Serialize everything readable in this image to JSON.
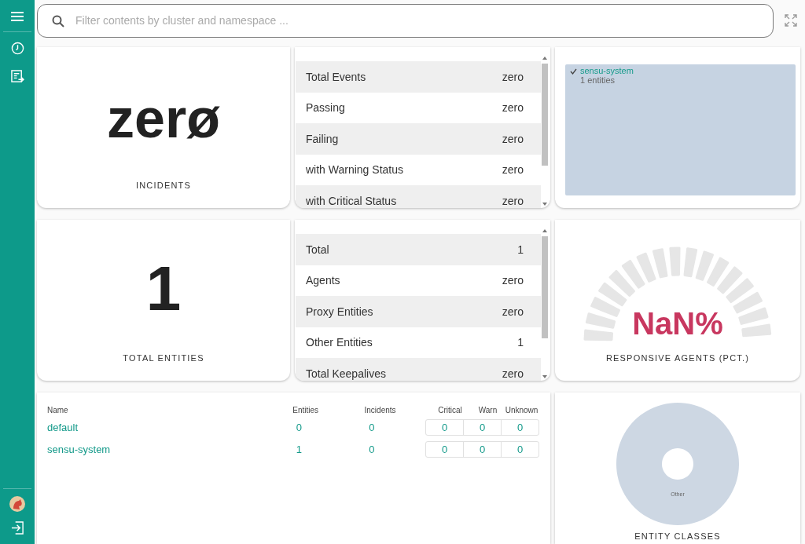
{
  "search": {
    "placeholder": "Filter contents by cluster and namespace ..."
  },
  "incidents": {
    "value": "zerø",
    "label": "INCIDENTS"
  },
  "event_stats": {
    "rows": [
      {
        "label": "Total Events",
        "value": "zero"
      },
      {
        "label": "Passing",
        "value": "zero"
      },
      {
        "label": "Failing",
        "value": "zero"
      },
      {
        "label": "with Warning Status",
        "value": "zero"
      },
      {
        "label": "with Critical Status",
        "value": "zero"
      }
    ]
  },
  "namespace_filter": {
    "items": [
      {
        "name": "sensu-system",
        "detail": "1 entities",
        "checked": true
      }
    ]
  },
  "entities": {
    "value": "1",
    "label": "TOTAL ENTITIES"
  },
  "entity_stats": {
    "rows": [
      {
        "label": "Total",
        "value": "1"
      },
      {
        "label": "Agents",
        "value": "zero"
      },
      {
        "label": "Proxy Entities",
        "value": "zero"
      },
      {
        "label": "Other Entities",
        "value": "1"
      },
      {
        "label": "Total Keepalives",
        "value": "zero"
      }
    ]
  },
  "responsive_agents": {
    "value": "NaN%",
    "label": "RESPONSIVE AGENTS (PCT.)"
  },
  "namespaces_table": {
    "columns": [
      "Name",
      "Entities",
      "Incidents",
      "Critical",
      "Warn",
      "Unknown"
    ],
    "rows": [
      {
        "name": "default",
        "entities": "0",
        "incidents": "0",
        "critical": "0",
        "warn": "0",
        "unknown": "0"
      },
      {
        "name": "sensu-system",
        "entities": "1",
        "incidents": "0",
        "critical": "0",
        "warn": "0",
        "unknown": "0"
      }
    ]
  },
  "entity_classes": {
    "slice_labels": [
      "Other"
    ],
    "label": "ENTITY CLASSES"
  }
}
